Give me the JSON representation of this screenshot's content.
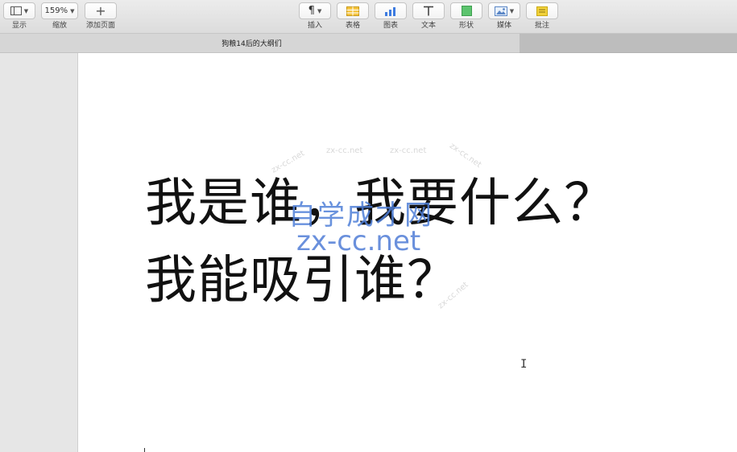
{
  "toolbar": {
    "view_label": "显示",
    "zoom_value": "159%",
    "zoom_label": "缩放",
    "add_page_label": "添加页面",
    "insert_label": "插入",
    "table_label": "表格",
    "chart_label": "图表",
    "text_label": "文本",
    "shape_label": "形状",
    "media_label": "媒体",
    "comment_label": "批注"
  },
  "document": {
    "title": "狗粮14后的大纲们"
  },
  "content": {
    "line1": "我是谁，我要什么？",
    "line2": "我能吸引谁？"
  },
  "watermark": {
    "cn": "自学成才网",
    "en": "zx-cc.net",
    "faint": "zx-cc.net"
  },
  "colors": {
    "table_icon": "#f5c542",
    "chart_icon": "#3d7be0",
    "shape_icon": "#5cc46e",
    "comment_icon": "#f2d23a"
  }
}
